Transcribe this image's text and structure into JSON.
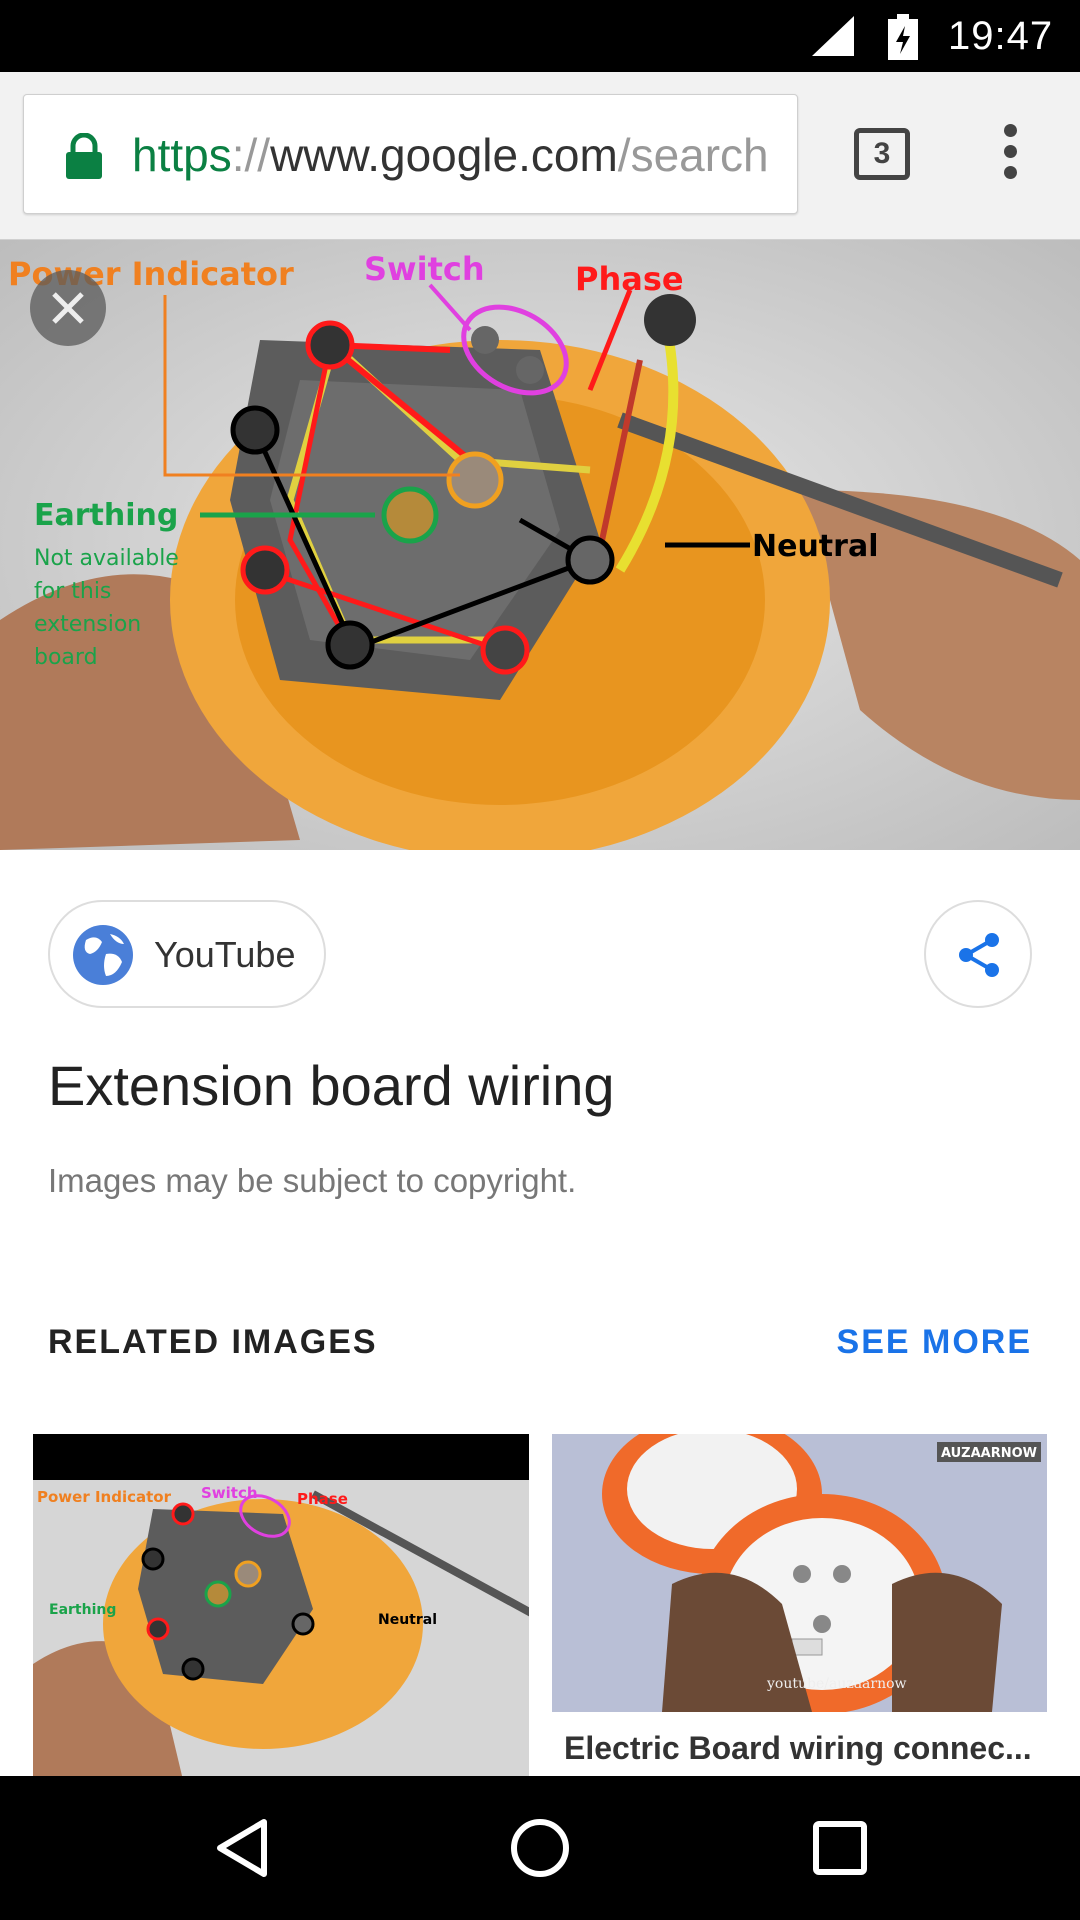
{
  "status_bar": {
    "time": "19:47",
    "signal_icon": "signal-icon",
    "battery_icon": "battery-charging-icon"
  },
  "browser": {
    "url_scheme": "https",
    "url_sep": "://",
    "url_host": "www.google.com",
    "url_path": "/search",
    "tab_count": "3",
    "lock_icon": "lock-icon",
    "menu_icon": "more-vert-icon"
  },
  "hero_image": {
    "labels": {
      "power_indicator": "Power Indicator",
      "switch": "Switch",
      "phase": "Phase",
      "earthing": "Earthing",
      "not_available": [
        "Not available",
        "for this",
        "extension",
        "board"
      ],
      "neutral": "Neutral"
    }
  },
  "source": {
    "label": "YouTube",
    "icon": "globe-icon"
  },
  "share_icon": "share-icon",
  "title": "Extension board wiring",
  "copyright": "Images may be subject to copyright.",
  "related": {
    "heading": "RELATED IMAGES",
    "see_more": "SEE MORE",
    "items": [
      {
        "labels": {
          "power_indicator": "Power Indicator",
          "switch": "Switch",
          "phase": "Phase",
          "earthing": "Earthing",
          "neutral": "Neutral"
        }
      },
      {
        "caption": "Electric Board wiring connec...",
        "watermark": "AUZAARNOW",
        "footer": "youtube/auzaarnow"
      }
    ]
  },
  "nav": {
    "back_icon": "back-icon",
    "home_icon": "home-icon",
    "recents_icon": "recents-icon"
  },
  "colors": {
    "accent": "#1a73e8",
    "secure_green": "#0b8043"
  }
}
